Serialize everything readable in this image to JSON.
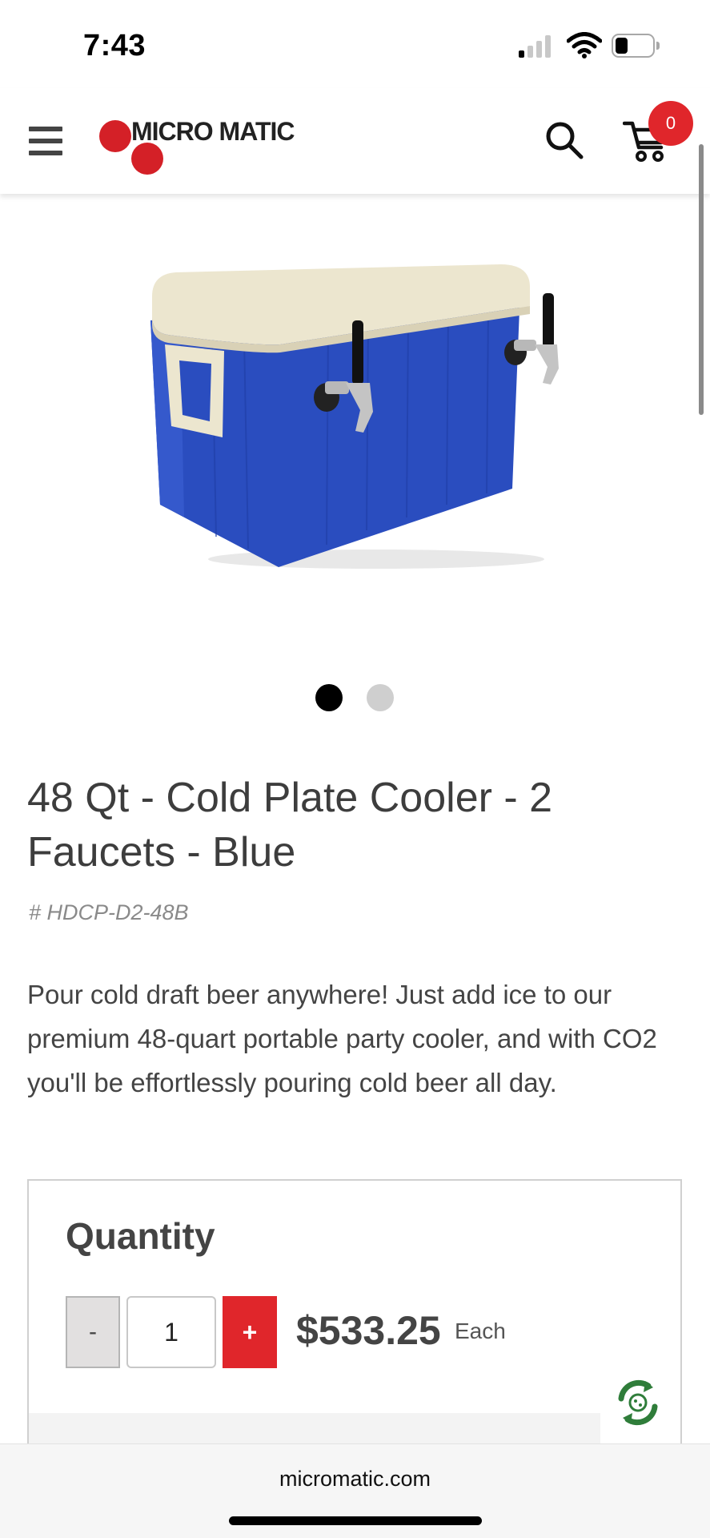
{
  "status_bar": {
    "time": "7:43"
  },
  "header": {
    "brand": "MICRO MATIC",
    "brand_color": "#d42027",
    "cart_count": "0",
    "icons": [
      "menu-icon",
      "search-icon",
      "cart-icon"
    ]
  },
  "product": {
    "image_alt": "48 Qt cold plate cooler, blue body with white lid and two faucets",
    "carousel": {
      "count": 2,
      "active_index": 0
    },
    "title": "48 Qt - Cold Plate Cooler - 2 Faucets - Blue",
    "sku": "# HDCP-D2-48B",
    "description": "Pour cold draft beer anywhere! Just add ice to our premium 48-quart portable party cooler, and with CO2 you'll be effortlessly pouring cold beer all day."
  },
  "purchase": {
    "heading": "Quantity",
    "minus_label": "-",
    "quantity": "1",
    "plus_label": "+",
    "price": "$533.25",
    "unit": "Each",
    "accent_color": "#e0262b"
  },
  "browser": {
    "url": "micromatic.com"
  }
}
